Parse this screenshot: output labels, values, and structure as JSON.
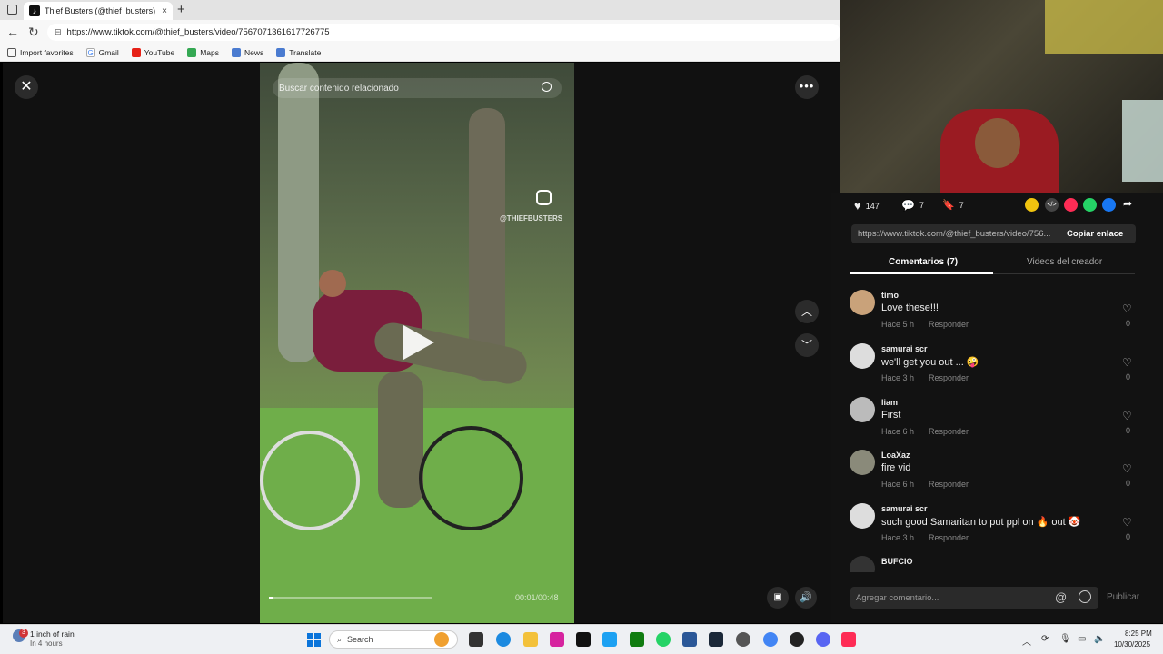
{
  "browser": {
    "tab_title": "Thief Busters (@thief_busters) | Ti",
    "tab_close": "×",
    "new_tab": "+",
    "url": "https://www.tiktok.com/@thief_busters/video/7567071361617726775",
    "bookmarks": [
      "Import favorites",
      "Gmail",
      "YouTube",
      "Maps",
      "News",
      "Translate"
    ]
  },
  "viewer": {
    "search_placeholder": "Buscar contenido relacionado",
    "watermark": "@THIEFBUSTERS",
    "time": "00:01/00:48",
    "progress_fraction": 0.03
  },
  "stats": {
    "likes": "147",
    "comments": "7",
    "saves": "7"
  },
  "share": {
    "link": "https://www.tiktok.com/@thief_busters/video/756...",
    "copy_label": "Copiar enlace"
  },
  "tabs": {
    "comments": "Comentarios (7)",
    "videos": "Videos del creador"
  },
  "comments": [
    {
      "user": "timo",
      "text": "Love these!!!",
      "time": "Hace 5 h",
      "reply": "Responder",
      "likes": "0",
      "avatar_color": "#c9a27a"
    },
    {
      "user": "samurai scr",
      "text": "we'll get you out ... 🤪",
      "time": "Hace 3 h",
      "reply": "Responder",
      "likes": "0",
      "avatar_color": "#ddd"
    },
    {
      "user": "liam",
      "text": "First",
      "time": "Hace 6 h",
      "reply": "Responder",
      "likes": "0",
      "avatar_color": "#bbb"
    },
    {
      "user": "LoaXaz",
      "text": "fire vid",
      "time": "Hace 6 h",
      "reply": "Responder",
      "likes": "0",
      "avatar_color": "#8a8a7a"
    },
    {
      "user": "samurai scr",
      "text": "such good Samaritan to put ppl on 🔥 out 🤡",
      "time": "Hace 3 h",
      "reply": "Responder",
      "likes": "0",
      "avatar_color": "#ddd"
    },
    {
      "user": "BUFCIO",
      "text": "",
      "time": "",
      "reply": "",
      "likes": "",
      "avatar_color": "#333"
    }
  ],
  "composer": {
    "placeholder": "Agregar comentario...",
    "publish": "Publicar"
  },
  "taskbar": {
    "weather_main": "1 inch of rain",
    "weather_sub": "In 4 hours",
    "weather_badge": "3",
    "search": "Search",
    "time": "8:25 PM",
    "date": "10/30/2025"
  }
}
